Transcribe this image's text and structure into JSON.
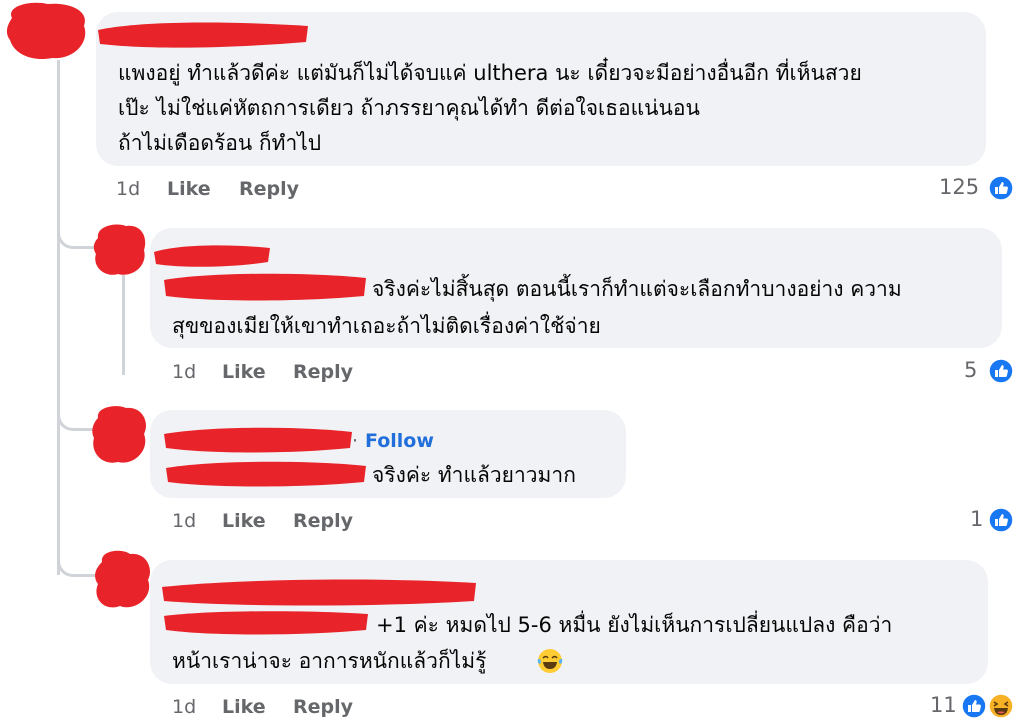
{
  "comments": [
    {
      "text_lines": [
        "แพงอยู่ ทำแล้วดีค่ะ แต่มันก็ไม่ได้จบแค่ ulthera นะ เดี๋ยวจะมีอย่างอื่นอีก ที่เห็นสวย",
        "เป๊ะ ไม่ใช่แค่หัตถการเดียว ถ้าภรรยาคุณได้ทำ ดีต่อใจเธอแน่นอน",
        "ถ้าไม่เดือดร้อน ก็ทำไป"
      ],
      "time": "1d",
      "like_label": "Like",
      "reply_label": "Reply",
      "reaction_count": "125",
      "reactions": [
        "like-icon"
      ]
    },
    {
      "text_lines": [
        "จริงค่ะไม่สิ้นสุด ตอนนี้เราก็ทำแต่จะเลือกทำบางอย่าง ความ",
        "สุขของเมียให้เขาทำเถอะถ้าไม่ติดเรื่องค่าใช้จ่าย"
      ],
      "time": "1d",
      "like_label": "Like",
      "reply_label": "Reply",
      "reaction_count": "5",
      "reactions": [
        "like-icon"
      ]
    },
    {
      "follow_label": "Follow",
      "text_lines": [
        "จริงค่ะ ทำแล้วยาวมาก"
      ],
      "time": "1d",
      "like_label": "Like",
      "reply_label": "Reply",
      "reaction_count": "1",
      "reactions": [
        "like-icon"
      ]
    },
    {
      "text_lines": [
        "+1 ค่ะ หมดไป 5-6 หมื่น ยังไม่เห็นการเปลี่ยนแปลง คือว่า",
        "หน้าเราน่าจะ อาการหนักแล้วก็ไม่รู้"
      ],
      "inline_emoji": "laughing-tears-emoji",
      "time": "1d",
      "like_label": "Like",
      "reply_label": "Reply",
      "reaction_count": "11",
      "reactions": [
        "like-icon",
        "haha-icon"
      ]
    }
  ],
  "colors": {
    "bubble": "#f0f2f5",
    "meta": "#65676b",
    "follow": "#216fdb",
    "like": "#1877f2",
    "haha": "#f7b125",
    "redaction": "#e8242a"
  }
}
